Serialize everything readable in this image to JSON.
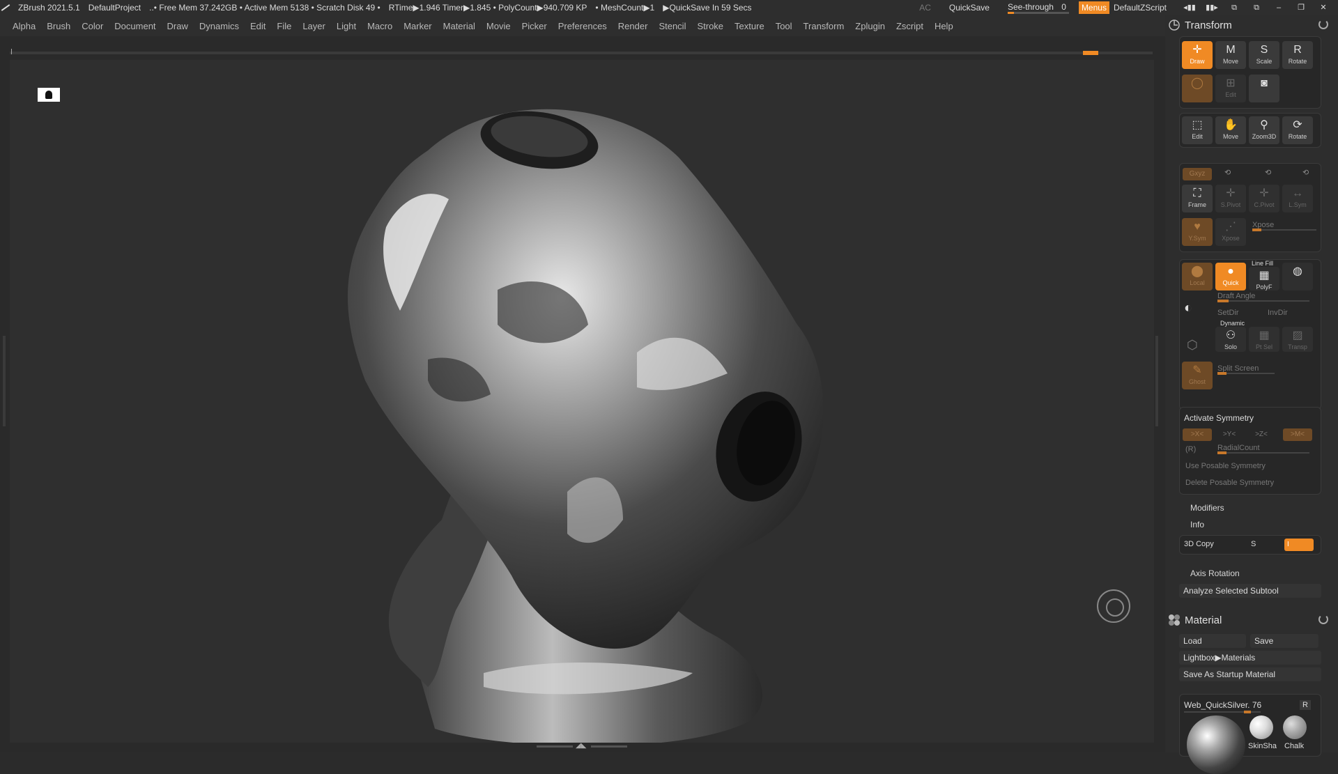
{
  "titlebar": {
    "app": "ZBrush 2021.5.1",
    "project": "DefaultProject",
    "mem": "..• Free Mem 37.242GB • Active Mem 5138 • Scratch Disk 49 •",
    "rtime": "RTime▶1.946 Timer▶1.845 • PolyCount▶940.709 KP",
    "meshcount": "• MeshCount▶1",
    "quicksave_status": "▶QuickSave In 59 Secs",
    "ac": "AC",
    "quicksave": "QuickSave",
    "seethrough_label": "See-through",
    "seethrough_value": "0",
    "menus": "Menus",
    "default_script": "DefaultZScript"
  },
  "menubar": {
    "items": [
      "Alpha",
      "Brush",
      "Color",
      "Document",
      "Draw",
      "Dynamics",
      "Edit",
      "File",
      "Layer",
      "Light",
      "Macro",
      "Marker",
      "Material",
      "Movie",
      "Picker",
      "Preferences",
      "Render",
      "Stencil",
      "Stroke",
      "Texture",
      "Tool",
      "Transform",
      "Zplugin",
      "Zscript",
      "Help"
    ]
  },
  "transform": {
    "title": "Transform",
    "row1": [
      "Draw",
      "Move",
      "Scale",
      "Rotate"
    ],
    "row2_3": "Edit",
    "row3": [
      "Edit",
      "Move",
      "Zoom3D",
      "Rotate"
    ],
    "row4_label": "Gxyz",
    "row5": [
      "Frame",
      "S.Pivot",
      "C.Pivot",
      "L.Sym"
    ],
    "row6": [
      "Y.Sym",
      "Xpose"
    ],
    "xpose_label": "Xpose",
    "row7": [
      "Local",
      "Quick",
      "PolyF"
    ],
    "linefill": "Line Fill",
    "draft_angle": "Draft Angle",
    "setdir": "SetDir",
    "invdir": "InvDir",
    "dynamic": "Dynamic",
    "row9": [
      "Solo",
      "Pt Sel",
      "Transp"
    ],
    "ghost": "Ghost",
    "split_screen": "Split Screen",
    "activate_symmetry": "Activate Symmetry",
    "sym_buttons": [
      ">X<",
      ">Y<",
      ">Z<",
      ">M<"
    ],
    "r_label": "(R)",
    "radial_count": "RadialCount",
    "use_posable": "Use Posable Symmetry",
    "delete_posable": "Delete Posable Symmetry",
    "modifiers": "Modifiers",
    "info": "Info",
    "copy3d": "3D Copy",
    "s_label": "S",
    "i_label": "I",
    "axis_rotation": "Axis Rotation",
    "analyze": "Analyze Selected Subtool"
  },
  "material": {
    "title": "Material",
    "load": "Load",
    "save": "Save",
    "lightbox": "Lightbox▶Materials",
    "save_startup": "Save As Startup Material",
    "current": "Web_QuickSilver. 76",
    "r": "R",
    "thumbs": [
      "SkinSha",
      "Chalk"
    ]
  },
  "colors": {
    "accent": "#f08a24"
  },
  "seethrough_fraction": 0.1
}
